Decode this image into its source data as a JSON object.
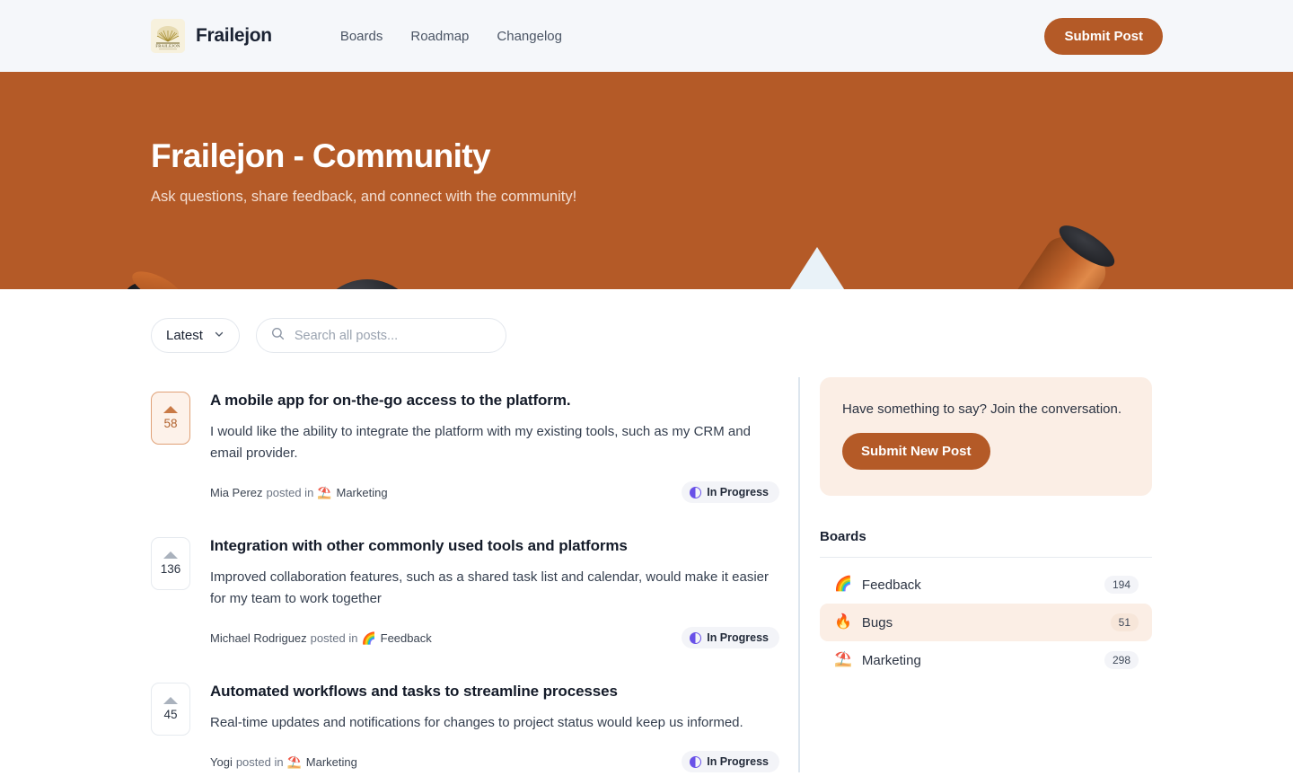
{
  "header": {
    "logo_icon": "frailejon-logo",
    "brand": "Frailejon",
    "nav": [
      {
        "label": "Boards"
      },
      {
        "label": "Roadmap"
      },
      {
        "label": "Changelog"
      }
    ],
    "cta_label": "Submit Post"
  },
  "hero": {
    "title": "Frailejon - Community",
    "subtitle": "Ask questions, share feedback, and connect with the community!",
    "background_color": "#b45a27"
  },
  "controls": {
    "sort_value": "Latest",
    "sort_icon": "chevron-down-icon",
    "search_icon": "search-icon",
    "search_value": "",
    "search_placeholder": "Search all posts..."
  },
  "posts": [
    {
      "votes": "58",
      "voted": true,
      "title": "A mobile app for on-the-go access to the platform.",
      "description": "I would like the ability to integrate the platform with my existing tools, such as my CRM and email provider.",
      "author": "Mia Perez",
      "posted_in": "posted in",
      "board": "Marketing",
      "board_emoji": "⛱️",
      "status": "In Progress",
      "status_icon": "half-circle-icon"
    },
    {
      "votes": "136",
      "voted": false,
      "title": "Integration with other commonly used tools and platforms",
      "description": "Improved collaboration features, such as a shared task list and calendar, would make it easier for my team to work together",
      "author": "Michael Rodriguez",
      "posted_in": "posted in",
      "board": "Feedback",
      "board_emoji": "🌈",
      "status": "In Progress",
      "status_icon": "half-circle-icon"
    },
    {
      "votes": "45",
      "voted": false,
      "title": "Automated workflows and tasks to streamline processes",
      "description": "Real-time updates and notifications for changes to project status would keep us informed.",
      "author": "Yogi",
      "posted_in": "posted in",
      "board": "Marketing",
      "board_emoji": "⛱️",
      "status": "In Progress",
      "status_icon": "half-circle-icon"
    }
  ],
  "sidebar": {
    "cta_text": "Have something to say? Join the conversation.",
    "cta_button": "Submit New Post",
    "boards_heading": "Boards",
    "boards": [
      {
        "emoji": "🌈",
        "label": "Feedback",
        "count": "194",
        "selected": false
      },
      {
        "emoji": "🔥",
        "label": "Bugs",
        "count": "51",
        "selected": true
      },
      {
        "emoji": "⛱️",
        "label": "Marketing",
        "count": "298",
        "selected": false
      }
    ]
  }
}
